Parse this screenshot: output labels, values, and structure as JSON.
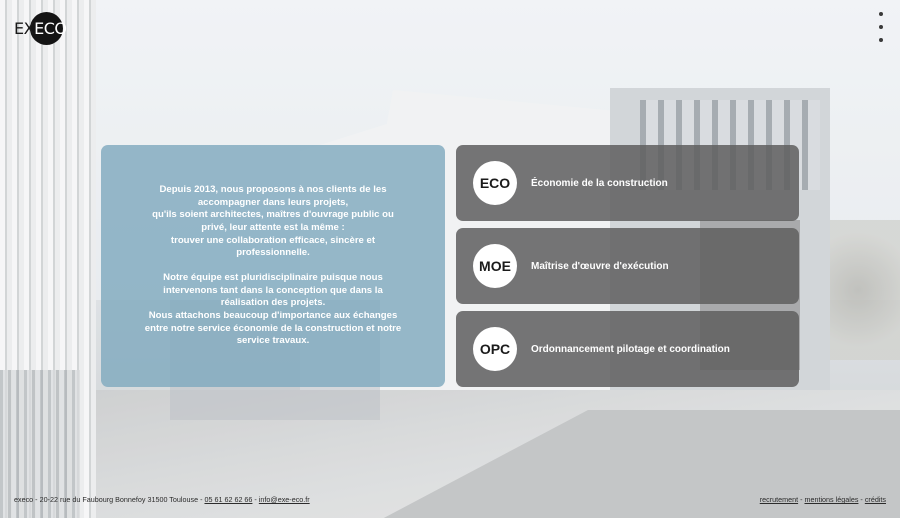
{
  "brand": {
    "logo_left": "EX",
    "logo_right": "ECO"
  },
  "intro": {
    "text": "Depuis 2013, nous proposons à nos clients de les accompagner dans leurs projets,\nqu'ils soient architectes, maîtres d'ouvrage public ou privé, leur attente est la même  :\ntrouver une collaboration efficace, sincère et professionnelle.\n\nNotre équipe est pluridisciplinaire puisque nous intervenons tant dans la conception que dans la réalisation des projets.\nNous attachons beaucoup d'importance aux échanges entre notre service économie de la construction et notre service travaux."
  },
  "services": [
    {
      "code": "ECO",
      "label": "Économie de la construction"
    },
    {
      "code": "MOE",
      "label": "Maîtrise d'œuvre d'exécution"
    },
    {
      "code": "OPC",
      "label": "Ordonnancement pilotage et coordination"
    }
  ],
  "footer": {
    "address": "execo - 20-22 rue du Faubourg Bonnefoy 31500 Toulouse - ",
    "phone": "05 61 62 62 66",
    "separator": " - ",
    "email": "info@exe-eco.fr",
    "links": [
      "recrutement",
      "mentions légales",
      "crédits"
    ],
    "link_separator": " - "
  },
  "colors": {
    "intro_panel": "#80AABE",
    "service_card": "#606060",
    "badge": "#FFFFFF"
  },
  "icons": {
    "menu": "kebab-menu-icon"
  }
}
